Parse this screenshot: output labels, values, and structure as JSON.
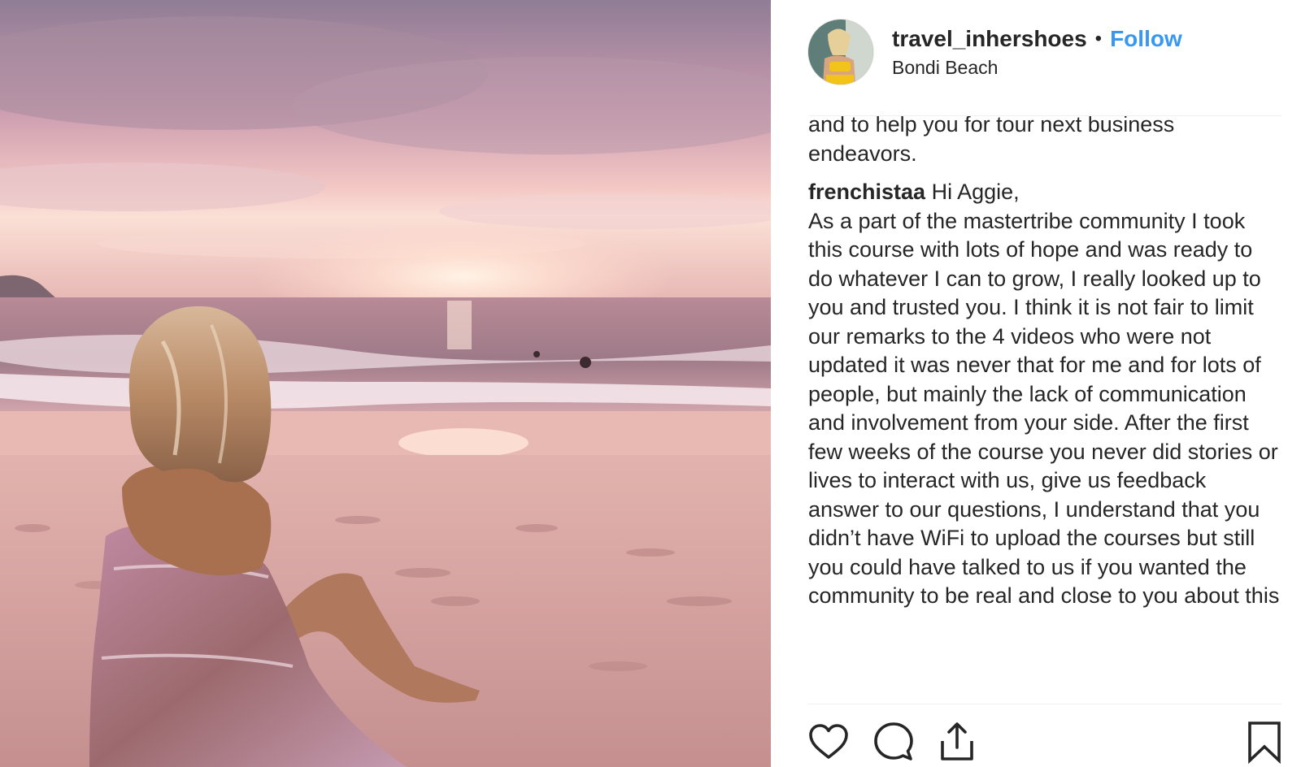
{
  "post": {
    "username": "travel_inhershoes",
    "separator": "•",
    "follow_label": "Follow",
    "location": "Bondi Beach"
  },
  "comments": {
    "continued_text": "and to help you for tour next business endeavors.",
    "items": [
      {
        "username": "frenchistaa",
        "greeting": "Hi Aggie,",
        "body": "As a part of the mastertribe community I took this course with lots of hope and was ready to do whatever I can to grow, I really looked up to you and trusted you. I think it is not fair to limit our remarks to the 4 videos who were not updated it was never that for me and for lots of people, but mainly the lack of communication and involvement from your side. After the first few weeks of the course you never did stories or lives to interact with us, give us feedback answer to our questions, I understand that you didn’t have WiFi to upload the courses but still you could have talked to us if you wanted the community to be real and close to you about this"
      }
    ]
  },
  "actions": {
    "like_icon": "heart-icon",
    "comment_icon": "comment-bubble-icon",
    "share_icon": "share-icon",
    "save_icon": "bookmark-icon"
  },
  "colors": {
    "follow_blue": "#3897f0",
    "text": "#262626",
    "divider": "#efefef"
  }
}
